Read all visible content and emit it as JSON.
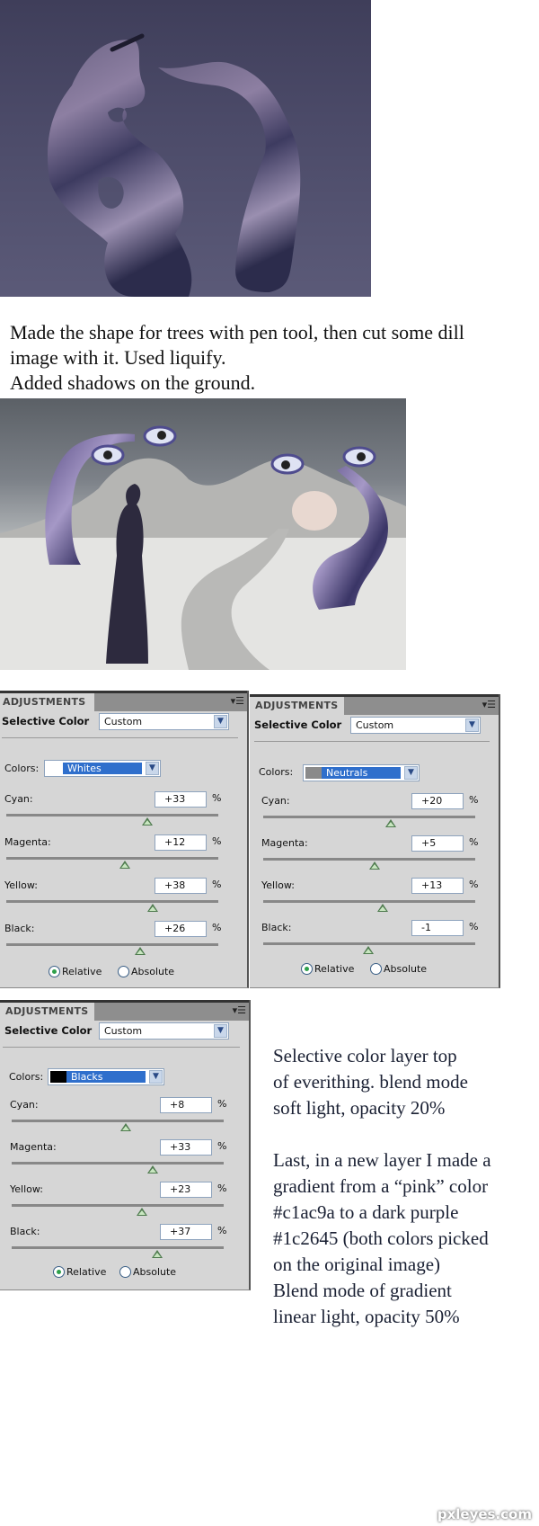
{
  "step_images": [
    {
      "alt": "Tree shapes cut from dill image on purple background"
    },
    {
      "alt": "Surreal scene with woman on road, twisted trees with eyes, rocky hills"
    }
  ],
  "caption_1": {
    "lines": [
      "Made the shape for trees with pen tool, then cut some dill",
      "image with it. Used liquify.",
      "Added shadows on the ground."
    ]
  },
  "panels": [
    {
      "tab_label": "ADJUSTMENTS",
      "title": "Selective Color",
      "preset": "Custom",
      "colors_label": "Colors:",
      "colors_value": "Whites",
      "swatch_color": "#ffffff",
      "sliders": [
        {
          "label": "Cyan:",
          "value": "+33",
          "unit": "%",
          "percent": 33
        },
        {
          "label": "Magenta:",
          "value": "+12",
          "unit": "%",
          "percent": 12
        },
        {
          "label": "Yellow:",
          "value": "+38",
          "unit": "%",
          "percent": 38
        },
        {
          "label": "Black:",
          "value": "+26",
          "unit": "%",
          "percent": 26
        }
      ],
      "method": {
        "relative": "Relative",
        "absolute": "Absolute",
        "selected": "relative"
      }
    },
    {
      "tab_label": "ADJUSTMENTS",
      "title": "Selective Color",
      "preset": "Custom",
      "colors_label": "Colors:",
      "colors_value": "Neutrals",
      "swatch_color": "#8a8a8a",
      "sliders": [
        {
          "label": "Cyan:",
          "value": "+20",
          "unit": "%",
          "percent": 20
        },
        {
          "label": "Magenta:",
          "value": "+5",
          "unit": "%",
          "percent": 5
        },
        {
          "label": "Yellow:",
          "value": "+13",
          "unit": "%",
          "percent": 13
        },
        {
          "label": "Black:",
          "value": "-1",
          "unit": "%",
          "percent": -1
        }
      ],
      "method": {
        "relative": "Relative",
        "absolute": "Absolute",
        "selected": "relative"
      }
    },
    {
      "tab_label": "ADJUSTMENTS",
      "title": "Selective Color",
      "preset": "Custom",
      "colors_label": "Colors:",
      "colors_value": "Blacks",
      "swatch_color": "#000000",
      "sliders": [
        {
          "label": "Cyan:",
          "value": "+8",
          "unit": "%",
          "percent": 8
        },
        {
          "label": "Magenta:",
          "value": "+33",
          "unit": "%",
          "percent": 33
        },
        {
          "label": "Yellow:",
          "value": "+23",
          "unit": "%",
          "percent": 23
        },
        {
          "label": "Black:",
          "value": "+37",
          "unit": "%",
          "percent": 37
        }
      ],
      "method": {
        "relative": "Relative",
        "absolute": "Absolute",
        "selected": "relative"
      }
    }
  ],
  "caption_2": {
    "para1": [
      "Selective color layer top",
      "of everithing. blend mode",
      "soft light, opacity 20%"
    ],
    "para2": [
      "Last, in a new layer I made a",
      "gradient from a “pink” color",
      "#c1ac9a to a dark purple",
      "#1c2645 (both colors picked",
      "on the original image)",
      "Blend mode of gradient",
      "linear light, opacity 50%"
    ]
  },
  "colors": {
    "gradient_pink": "#c1ac9a",
    "gradient_dark_purple": "#1c2645"
  },
  "watermark": "pxleyes.com"
}
